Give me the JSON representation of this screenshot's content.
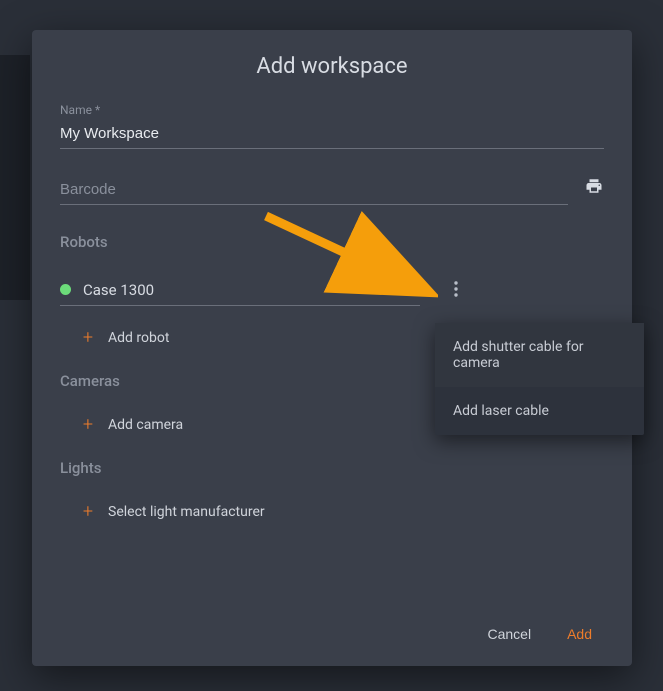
{
  "dialog": {
    "title": "Add workspace",
    "name_field": {
      "label": "Name *",
      "value": "My Workspace"
    },
    "barcode_field": {
      "placeholder": "Barcode",
      "value": ""
    }
  },
  "sections": {
    "robots": {
      "heading": "Robots",
      "selected": "Case 1300",
      "add_label": "Add robot"
    },
    "cameras": {
      "heading": "Cameras",
      "add_label": "Add camera"
    },
    "lights": {
      "heading": "Lights",
      "add_label": "Select light manufacturer"
    }
  },
  "popup": {
    "items": [
      "Add shutter cable for camera",
      "Add laser cable"
    ]
  },
  "actions": {
    "cancel": "Cancel",
    "add": "Add"
  },
  "colors": {
    "accent": "#ed7c2b",
    "status_ok": "#6cdc7a"
  }
}
